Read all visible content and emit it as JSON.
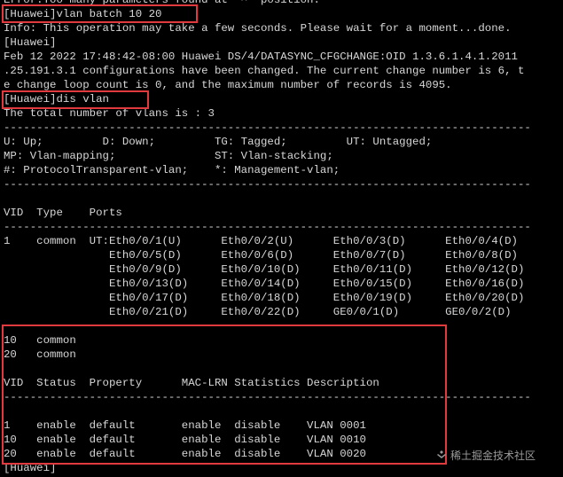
{
  "terminal": {
    "lines": [
      "Error:Too many parameters found at '^' position.",
      "[Huawei]vlan batch 10 20",
      "Info: This operation may take a few seconds. Please wait for a moment...done.",
      "[Huawei]",
      "Feb 12 2022 17:48:42-08:00 Huawei DS/4/DATASYNC_CFGCHANGE:OID 1.3.6.1.4.1.2011",
      ".25.191.3.1 configurations have been changed. The current change number is 6, t",
      "e change loop count is 0, and the maximum number of records is 4095.",
      "[Huawei]dis vlan",
      "The total number of vlans is : 3",
      "--------------------------------------------------------------------------------",
      "U: Up;         D: Down;         TG: Tagged;         UT: Untagged;",
      "MP: Vlan-mapping;               ST: Vlan-stacking;",
      "#: ProtocolTransparent-vlan;    *: Management-vlan;",
      "--------------------------------------------------------------------------------",
      "",
      "VID  Type    Ports",
      "--------------------------------------------------------------------------------",
      "1    common  UT:Eth0/0/1(U)      Eth0/0/2(U)      Eth0/0/3(D)      Eth0/0/4(D)",
      "                Eth0/0/5(D)      Eth0/0/6(D)      Eth0/0/7(D)      Eth0/0/8(D)",
      "                Eth0/0/9(D)      Eth0/0/10(D)     Eth0/0/11(D)     Eth0/0/12(D)",
      "                Eth0/0/13(D)     Eth0/0/14(D)     Eth0/0/15(D)     Eth0/0/16(D)",
      "                Eth0/0/17(D)     Eth0/0/18(D)     Eth0/0/19(D)     Eth0/0/20(D)",
      "                Eth0/0/21(D)     Eth0/0/22(D)     GE0/0/1(D)       GE0/0/2(D)",
      "",
      "10   common",
      "20   common",
      "",
      "VID  Status  Property      MAC-LRN Statistics Description",
      "--------------------------------------------------------------------------------",
      "",
      "1    enable  default       enable  disable    VLAN 0001",
      "10   enable  default       enable  disable    VLAN 0010",
      "20   enable  default       enable  disable    VLAN 0020",
      "[Huawei]"
    ]
  },
  "watermark": {
    "text": "稀土掘金技术社区"
  },
  "colors": {
    "background": "#000000",
    "text": "#d7d7d7",
    "highlight": "#e0393e"
  }
}
